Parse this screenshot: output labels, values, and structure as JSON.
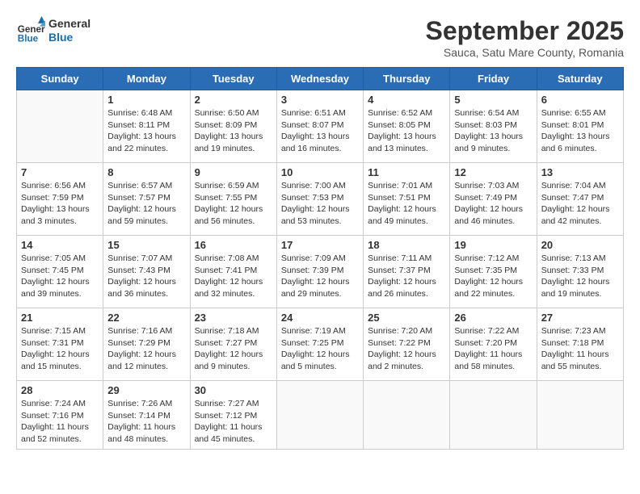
{
  "logo": {
    "general": "General",
    "blue": "Blue"
  },
  "title": "September 2025",
  "subtitle": "Sauca, Satu Mare County, Romania",
  "weekdays": [
    "Sunday",
    "Monday",
    "Tuesday",
    "Wednesday",
    "Thursday",
    "Friday",
    "Saturday"
  ],
  "weeks": [
    [
      {
        "day": "",
        "info": ""
      },
      {
        "day": "1",
        "info": "Sunrise: 6:48 AM\nSunset: 8:11 PM\nDaylight: 13 hours\nand 22 minutes."
      },
      {
        "day": "2",
        "info": "Sunrise: 6:50 AM\nSunset: 8:09 PM\nDaylight: 13 hours\nand 19 minutes."
      },
      {
        "day": "3",
        "info": "Sunrise: 6:51 AM\nSunset: 8:07 PM\nDaylight: 13 hours\nand 16 minutes."
      },
      {
        "day": "4",
        "info": "Sunrise: 6:52 AM\nSunset: 8:05 PM\nDaylight: 13 hours\nand 13 minutes."
      },
      {
        "day": "5",
        "info": "Sunrise: 6:54 AM\nSunset: 8:03 PM\nDaylight: 13 hours\nand 9 minutes."
      },
      {
        "day": "6",
        "info": "Sunrise: 6:55 AM\nSunset: 8:01 PM\nDaylight: 13 hours\nand 6 minutes."
      }
    ],
    [
      {
        "day": "7",
        "info": "Sunrise: 6:56 AM\nSunset: 7:59 PM\nDaylight: 13 hours\nand 3 minutes."
      },
      {
        "day": "8",
        "info": "Sunrise: 6:57 AM\nSunset: 7:57 PM\nDaylight: 12 hours\nand 59 minutes."
      },
      {
        "day": "9",
        "info": "Sunrise: 6:59 AM\nSunset: 7:55 PM\nDaylight: 12 hours\nand 56 minutes."
      },
      {
        "day": "10",
        "info": "Sunrise: 7:00 AM\nSunset: 7:53 PM\nDaylight: 12 hours\nand 53 minutes."
      },
      {
        "day": "11",
        "info": "Sunrise: 7:01 AM\nSunset: 7:51 PM\nDaylight: 12 hours\nand 49 minutes."
      },
      {
        "day": "12",
        "info": "Sunrise: 7:03 AM\nSunset: 7:49 PM\nDaylight: 12 hours\nand 46 minutes."
      },
      {
        "day": "13",
        "info": "Sunrise: 7:04 AM\nSunset: 7:47 PM\nDaylight: 12 hours\nand 42 minutes."
      }
    ],
    [
      {
        "day": "14",
        "info": "Sunrise: 7:05 AM\nSunset: 7:45 PM\nDaylight: 12 hours\nand 39 minutes."
      },
      {
        "day": "15",
        "info": "Sunrise: 7:07 AM\nSunset: 7:43 PM\nDaylight: 12 hours\nand 36 minutes."
      },
      {
        "day": "16",
        "info": "Sunrise: 7:08 AM\nSunset: 7:41 PM\nDaylight: 12 hours\nand 32 minutes."
      },
      {
        "day": "17",
        "info": "Sunrise: 7:09 AM\nSunset: 7:39 PM\nDaylight: 12 hours\nand 29 minutes."
      },
      {
        "day": "18",
        "info": "Sunrise: 7:11 AM\nSunset: 7:37 PM\nDaylight: 12 hours\nand 26 minutes."
      },
      {
        "day": "19",
        "info": "Sunrise: 7:12 AM\nSunset: 7:35 PM\nDaylight: 12 hours\nand 22 minutes."
      },
      {
        "day": "20",
        "info": "Sunrise: 7:13 AM\nSunset: 7:33 PM\nDaylight: 12 hours\nand 19 minutes."
      }
    ],
    [
      {
        "day": "21",
        "info": "Sunrise: 7:15 AM\nSunset: 7:31 PM\nDaylight: 12 hours\nand 15 minutes."
      },
      {
        "day": "22",
        "info": "Sunrise: 7:16 AM\nSunset: 7:29 PM\nDaylight: 12 hours\nand 12 minutes."
      },
      {
        "day": "23",
        "info": "Sunrise: 7:18 AM\nSunset: 7:27 PM\nDaylight: 12 hours\nand 9 minutes."
      },
      {
        "day": "24",
        "info": "Sunrise: 7:19 AM\nSunset: 7:25 PM\nDaylight: 12 hours\nand 5 minutes."
      },
      {
        "day": "25",
        "info": "Sunrise: 7:20 AM\nSunset: 7:22 PM\nDaylight: 12 hours\nand 2 minutes."
      },
      {
        "day": "26",
        "info": "Sunrise: 7:22 AM\nSunset: 7:20 PM\nDaylight: 11 hours\nand 58 minutes."
      },
      {
        "day": "27",
        "info": "Sunrise: 7:23 AM\nSunset: 7:18 PM\nDaylight: 11 hours\nand 55 minutes."
      }
    ],
    [
      {
        "day": "28",
        "info": "Sunrise: 7:24 AM\nSunset: 7:16 PM\nDaylight: 11 hours\nand 52 minutes."
      },
      {
        "day": "29",
        "info": "Sunrise: 7:26 AM\nSunset: 7:14 PM\nDaylight: 11 hours\nand 48 minutes."
      },
      {
        "day": "30",
        "info": "Sunrise: 7:27 AM\nSunset: 7:12 PM\nDaylight: 11 hours\nand 45 minutes."
      },
      {
        "day": "",
        "info": ""
      },
      {
        "day": "",
        "info": ""
      },
      {
        "day": "",
        "info": ""
      },
      {
        "day": "",
        "info": ""
      }
    ]
  ]
}
